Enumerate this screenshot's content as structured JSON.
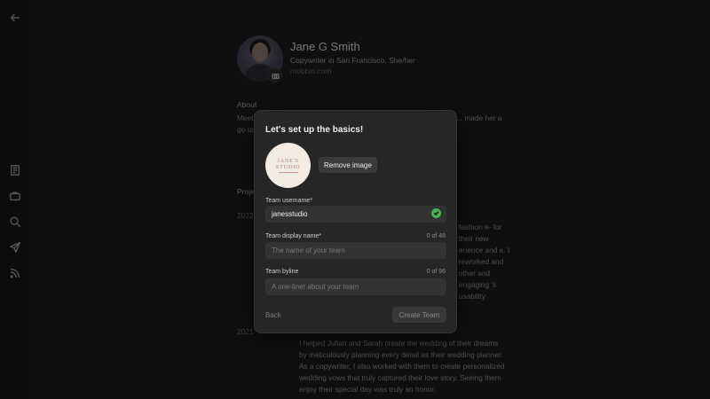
{
  "profile": {
    "name": "Jane G Smith",
    "subtitle": "Copywriter in San Francisco, She/her",
    "website": "mobbin.com",
    "about_label": "About",
    "about_text": "Meet Jane, a copywriter who loves crafting engaging content. Her s... made her a go-to... posts to webs...",
    "projects_label": "Proje",
    "year_1": "2022",
    "year_2": "2021",
    "project_1_text": "fashion e- for their new erience and e. I reworked and other and engaging 's usability",
    "project_2_text": "I helped Julian and Sarah create the wedding of their dreams by meticulously planning every detail as their wedding planner. As a copywriter, I also worked with them to create personalized wedding vows that truly captured their love story. Seeing them enjoy their special day was truly an honor."
  },
  "sidebar": {
    "icons": [
      "back-arrow-icon",
      "journal-icon",
      "briefcase-icon",
      "search-icon",
      "send-icon",
      "rss-icon"
    ]
  },
  "modal": {
    "title": "Let's set up the basics!",
    "logo_line1": "JANE'S",
    "logo_line2": "STUDIO",
    "remove_image_label": "Remove image",
    "username": {
      "label": "Team username*",
      "value": "janesstudio"
    },
    "display_name": {
      "label": "Team display name*",
      "count": "0 of 48",
      "placeholder": "The name of your team"
    },
    "byline": {
      "label": "Team byline",
      "count": "0 of 96",
      "placeholder": "A one-liner about your team"
    },
    "back_label": "Back",
    "create_label": "Create Team"
  },
  "colors": {
    "background": "#1c1c1c",
    "modal": "#262626",
    "input": "#333333",
    "success": "#4caf50",
    "logo_bg": "#f4ece2",
    "logo_text": "#b8857c"
  }
}
